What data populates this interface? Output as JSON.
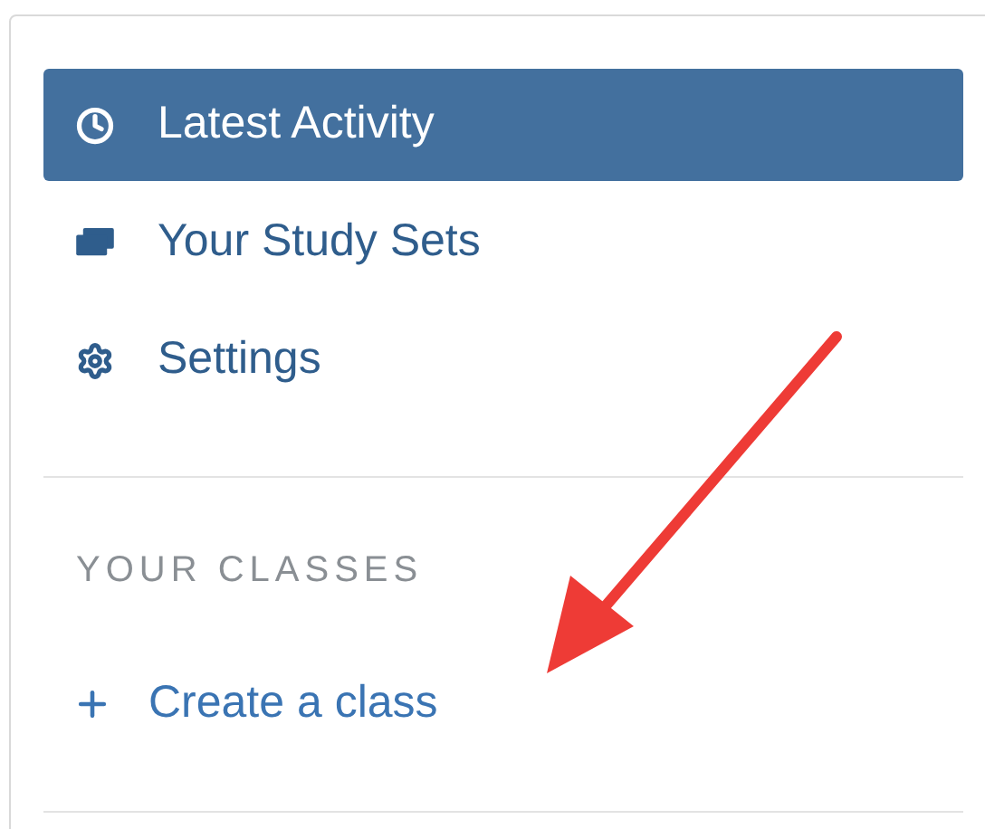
{
  "nav": {
    "items": [
      {
        "label": "Latest Activity",
        "selected": true
      },
      {
        "label": "Your Study Sets",
        "selected": false
      },
      {
        "label": "Settings",
        "selected": false
      }
    ]
  },
  "classes": {
    "heading": "YOUR CLASSES",
    "link": "Create a class"
  }
}
